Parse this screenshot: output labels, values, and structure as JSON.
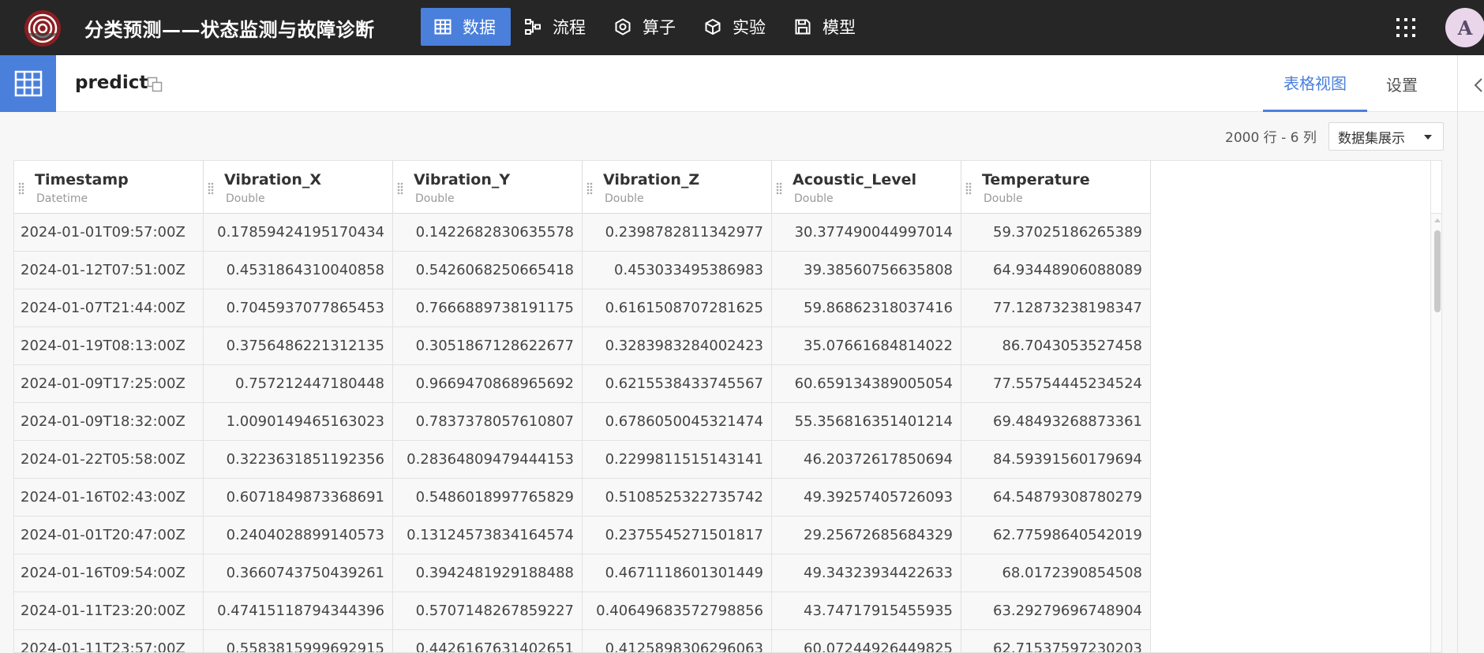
{
  "app": {
    "title": "分类预测——状态监测与故障诊断",
    "nav": [
      {
        "label": "数据",
        "icon": "table-icon",
        "active": true
      },
      {
        "label": "流程",
        "icon": "flow-icon",
        "active": false
      },
      {
        "label": "算子",
        "icon": "operator-icon",
        "active": false
      },
      {
        "label": "实验",
        "icon": "cube-icon",
        "active": false
      },
      {
        "label": "模型",
        "icon": "save-icon",
        "active": false
      }
    ],
    "avatar_letter": "A",
    "accent_color": "#4a7fdc",
    "topbar_color": "#262626"
  },
  "dataset": {
    "name": "predict",
    "tabs": {
      "table_view": "表格视图",
      "settings": "设置"
    },
    "row_count_text": "2000 行 - 6 列",
    "display_select": "数据集展示"
  },
  "table": {
    "columns": [
      {
        "name": "Timestamp",
        "type": "Datetime"
      },
      {
        "name": "Vibration_X",
        "type": "Double"
      },
      {
        "name": "Vibration_Y",
        "type": "Double"
      },
      {
        "name": "Vibration_Z",
        "type": "Double"
      },
      {
        "name": "Acoustic_Level",
        "type": "Double"
      },
      {
        "name": "Temperature",
        "type": "Double"
      }
    ],
    "rows": [
      [
        "2024-01-01T09:57:00Z",
        "0.17859424195170434",
        "0.1422682830635578",
        "0.2398782811342977",
        "30.377490044997014",
        "59.37025186265389"
      ],
      [
        "2024-01-12T07:51:00Z",
        "0.4531864310040858",
        "0.5426068250665418",
        "0.453033495386983",
        "39.38560756635808",
        "64.93448906088089"
      ],
      [
        "2024-01-07T21:44:00Z",
        "0.7045937077865453",
        "0.7666889738191175",
        "0.6161508707281625",
        "59.86862318037416",
        "77.12873238198347"
      ],
      [
        "2024-01-19T08:13:00Z",
        "0.3756486221312135",
        "0.3051867128622677",
        "0.3283983284002423",
        "35.07661684814022",
        "86.7043053527458"
      ],
      [
        "2024-01-09T17:25:00Z",
        "0.757212447180448",
        "0.9669470868965692",
        "0.6215538433745567",
        "60.659134389005054",
        "77.55754445234524"
      ],
      [
        "2024-01-09T18:32:00Z",
        "1.0090149465163023",
        "0.7837378057610807",
        "0.6786050045321474",
        "55.356816351401214",
        "69.48493268873361"
      ],
      [
        "2024-01-22T05:58:00Z",
        "0.3223631851192356",
        "0.28364809479444153",
        "0.2299811515143141",
        "46.20372617850694",
        "84.59391560179694"
      ],
      [
        "2024-01-16T02:43:00Z",
        "0.6071849873368691",
        "0.5486018997765829",
        "0.5108525322735742",
        "49.39257405726093",
        "64.54879308780279"
      ],
      [
        "2024-01-01T20:47:00Z",
        "0.2404028899140573",
        "0.13124573834164574",
        "0.2375545271501817",
        "29.25672685684329",
        "62.77598640542019"
      ],
      [
        "2024-01-16T09:54:00Z",
        "0.3660743750439261",
        "0.3942481929188488",
        "0.4671118601301449",
        "49.34323934422633",
        "68.0172390854508"
      ],
      [
        "2024-01-11T23:20:00Z",
        "0.47415118794344396",
        "0.5707148267859227",
        "0.40649683572798856",
        "43.74717915455935",
        "63.29279696748904"
      ],
      [
        "2024-01-11T23:57:00Z",
        "0.5583815999692915",
        "0.4426167631402651",
        "0.4125898306296063",
        "60.07244926449825",
        "62.71537597230203"
      ]
    ]
  }
}
